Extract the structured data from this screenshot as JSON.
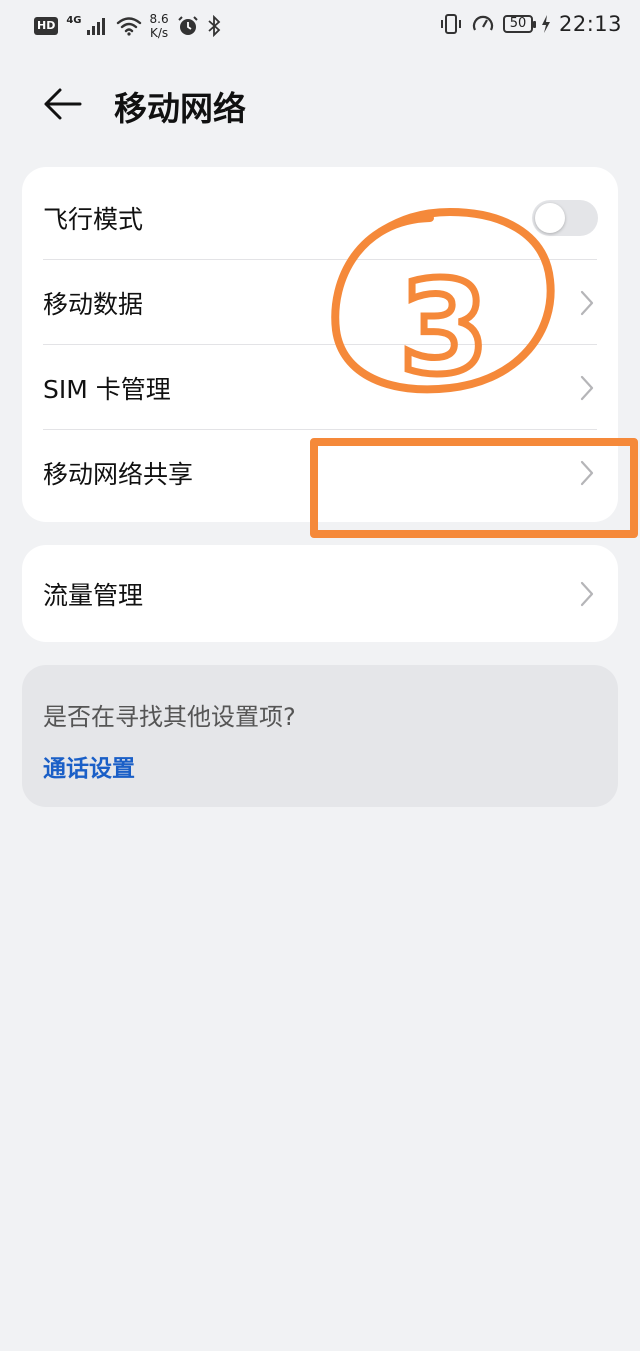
{
  "status_bar": {
    "hd": "HD",
    "net_type": "4G",
    "speed_value": "8.6",
    "speed_unit": "K/s",
    "battery": "50",
    "time": "22:13"
  },
  "header": {
    "title": "移动网络"
  },
  "main_list": {
    "items": [
      {
        "label": "飞行模式",
        "control": "toggle",
        "toggle_on": false
      },
      {
        "label": "移动数据",
        "control": "chevron"
      },
      {
        "label": "SIM 卡管理",
        "control": "chevron"
      },
      {
        "label": "移动网络共享",
        "control": "chevron"
      }
    ]
  },
  "traffic": {
    "label": "流量管理"
  },
  "suggestion": {
    "title": "是否在寻找其他设置项?",
    "link": "通话设置"
  },
  "annotation": {
    "color": "#f5893a",
    "circled_number": "3"
  },
  "colors": {
    "background": "#f1f2f4",
    "card": "#ffffff",
    "link": "#1a5fc7",
    "annotation": "#f5893a"
  }
}
